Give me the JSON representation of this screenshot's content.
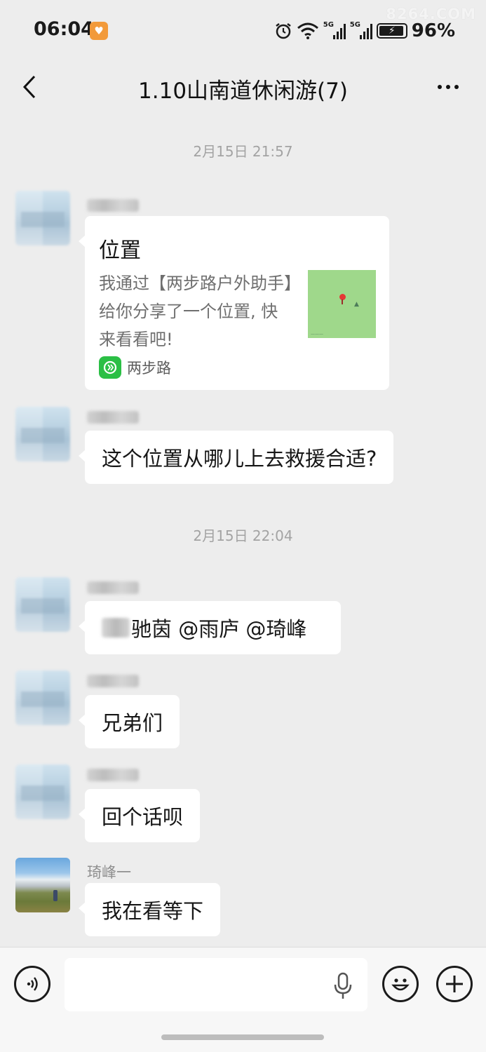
{
  "status_bar": {
    "time": "06:04",
    "network_1": "5G",
    "network_2": "5G",
    "battery_percent": "96%",
    "battery_level": 0.96,
    "watermark": "8264.COM",
    "icons": [
      "heart-app-icon",
      "alarm-icon",
      "wifi-icon",
      "signal-icon",
      "signal-icon",
      "battery-charging-icon"
    ]
  },
  "header": {
    "title": "1.10山南道休闲游(7)",
    "back_icon": "chevron-left-icon",
    "more_icon": "more-dots-icon"
  },
  "messages": {
    "timestamp_1": "2月15日 21:57",
    "location_card": {
      "title": "位置",
      "description": "我通过【两步路户外助手】给你分享了一个位置, 快来看看吧!",
      "source": "两步路",
      "source_icon": "two-step-road-app-icon",
      "map_thumbnail": "map-pin-thumbnail"
    },
    "msg_2": "这个位置从哪儿上去救援合适?",
    "timestamp_2": "2月15日 22:04",
    "msg_3": "驰茵 @雨庐 @琦峰",
    "msg_3_prefix": "@",
    "msg_4": "兄弟们",
    "msg_5": "回个话呗",
    "sender_6": "琦峰一",
    "msg_6": "我在看等下"
  },
  "input_bar": {
    "value": "",
    "icons": [
      "voice-icon",
      "mic-icon",
      "emoji-icon",
      "plus-icon"
    ]
  },
  "colors": {
    "background": "#ededed",
    "bubble": "#ffffff",
    "timestamp": "#a3a3a3",
    "source_brand": "#2bbf45"
  }
}
